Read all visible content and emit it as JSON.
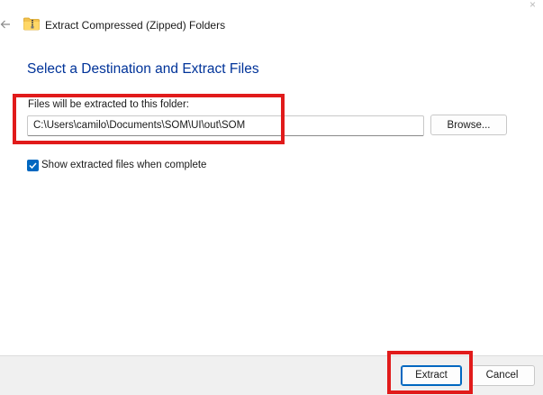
{
  "window": {
    "title": "Extract Compressed (Zipped) Folders"
  },
  "icons": {
    "back": "arrow-left-icon",
    "title": "zip-folder-icon",
    "checkbox": "checkmark-icon"
  },
  "main": {
    "heading": "Select a Destination and Extract Files",
    "destination_label": "Files will be extracted to this folder:",
    "destination_value": "C:\\Users\\camilo\\Documents\\SOM\\UI\\out\\SOM",
    "browse_label": "Browse...",
    "show_files_label": "Show extracted files when complete",
    "show_files_checked": true
  },
  "footer": {
    "extract_label": "Extract",
    "cancel_label": "Cancel"
  },
  "colors": {
    "heading": "#003399",
    "accent": "#0067c0",
    "highlight": "#e11b1b"
  }
}
